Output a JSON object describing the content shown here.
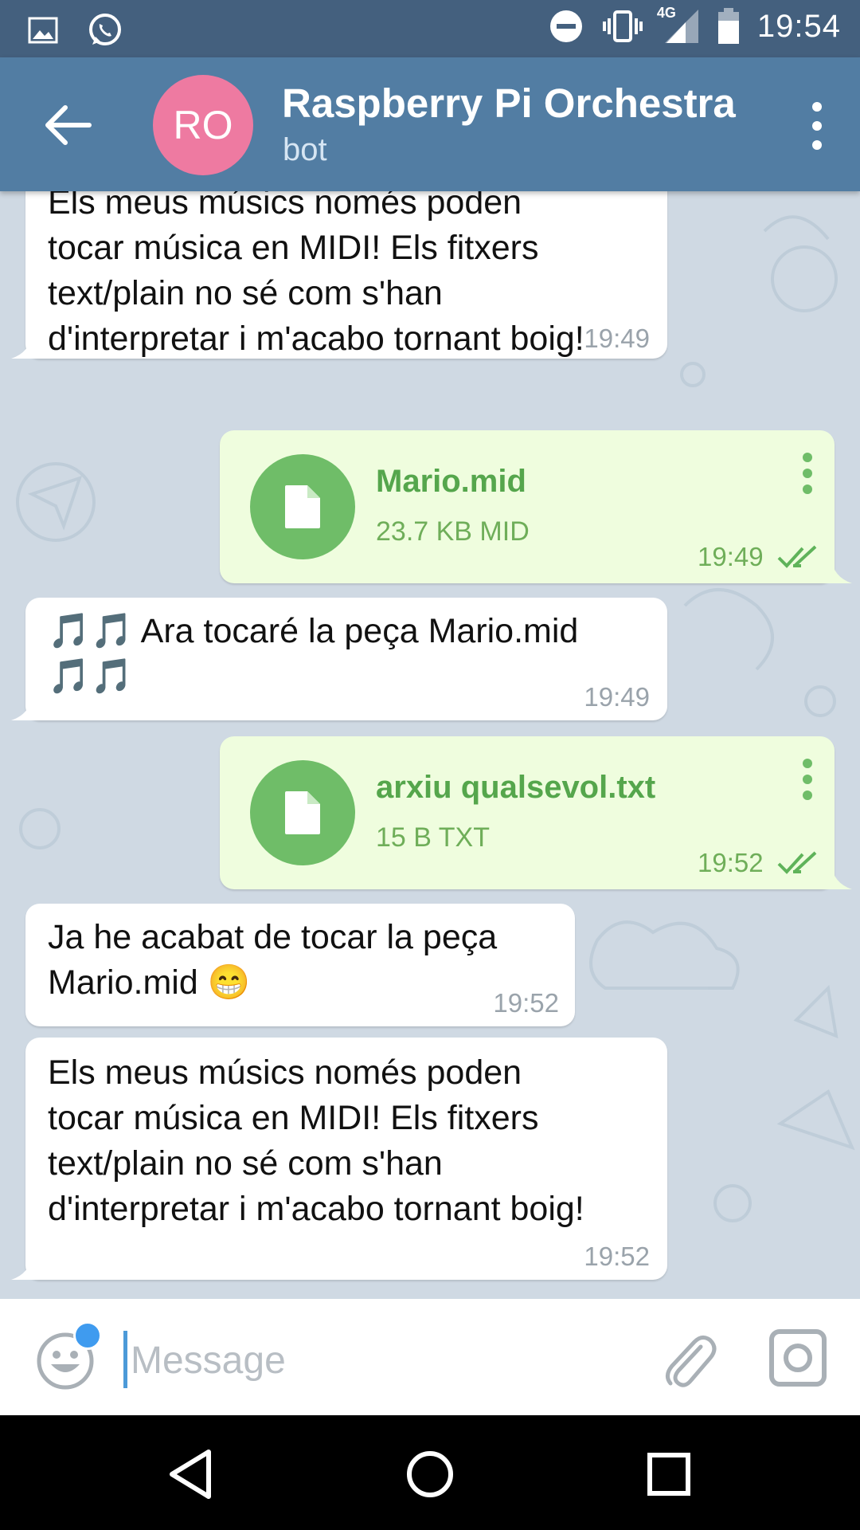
{
  "status_bar": {
    "time": "19:54",
    "network": "4G",
    "left_icons": [
      "image-icon",
      "whatsapp-icon"
    ],
    "right_icons": [
      "do-not-disturb-icon",
      "vibrate-icon",
      "signal-icon",
      "battery-icon"
    ]
  },
  "header": {
    "avatar_initials": "RO",
    "avatar_color": "#ee7aa1",
    "title": "Raspberry Pi Orchestra",
    "subtitle": "bot"
  },
  "messages": [
    {
      "type": "text",
      "direction": "in",
      "text": "Els meus músics només poden\ntocar música en MIDI! Els fitxers\ntext/plain no sé com s'han\nd'interpretar i m'acabo tornant boig!",
      "time": "19:49"
    },
    {
      "type": "file",
      "direction": "out",
      "file_name": "Mario.mid",
      "file_info": "23.7 KB MID",
      "time": "19:49",
      "status": "read"
    },
    {
      "type": "text",
      "direction": "in",
      "text": "🎵🎵 Ara tocaré la peça Mario.mid\n🎵🎵",
      "time": "19:49"
    },
    {
      "type": "file",
      "direction": "out",
      "file_name": "arxiu qualsevol.txt",
      "file_info": "15 B TXT",
      "time": "19:52",
      "status": "read"
    },
    {
      "type": "text",
      "direction": "in",
      "text": "Ja he acabat de tocar la peça\nMario.mid 😁",
      "time": "19:52"
    },
    {
      "type": "text",
      "direction": "in",
      "text": "Els meus músics només poden\ntocar música en MIDI! Els fitxers\ntext/plain no sé com s'han\nd'interpretar i m'acabo tornant boig!",
      "time": "19:52"
    }
  ],
  "composer": {
    "placeholder": "Message",
    "value": ""
  },
  "colors": {
    "status_bar": "#44607e",
    "header": "#527da3",
    "outgoing_bubble": "#effdde",
    "file_icon": "#6fbd68",
    "chat_background": "#cfd9e3"
  }
}
